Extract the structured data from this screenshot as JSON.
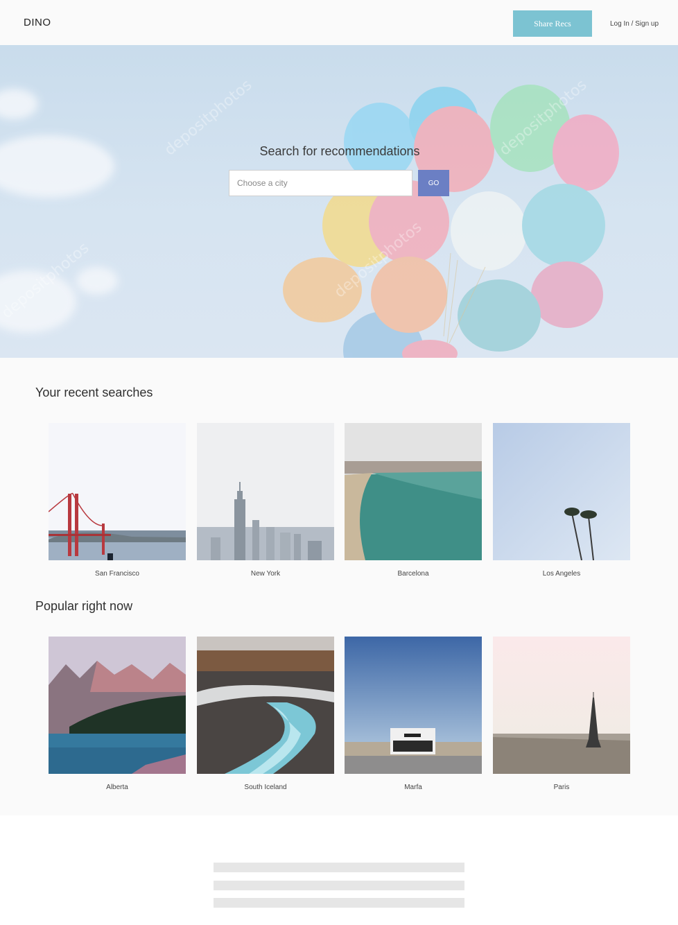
{
  "header": {
    "logo": "DINO",
    "share_button": "Share Recs",
    "login_link": "Log In / Sign up"
  },
  "hero": {
    "title": "Search for recommendations",
    "search_placeholder": "Choose a city",
    "go_button": "GO",
    "watermark": "depositphotos"
  },
  "recent": {
    "title": "Your recent searches",
    "cities": [
      {
        "name": "San Francisco",
        "icon": "golden-gate-photo"
      },
      {
        "name": "New York",
        "icon": "skyline-photo"
      },
      {
        "name": "Barcelona",
        "icon": "beach-photo"
      },
      {
        "name": "Los Angeles",
        "icon": "palm-trees-photo"
      }
    ]
  },
  "popular": {
    "title": "Popular right now",
    "cities": [
      {
        "name": "Alberta",
        "icon": "mountain-lake-photo"
      },
      {
        "name": "South Iceland",
        "icon": "waterfall-photo"
      },
      {
        "name": "Marfa",
        "icon": "desert-store-photo"
      },
      {
        "name": "Paris",
        "icon": "eiffel-tower-photo"
      }
    ]
  },
  "colors": {
    "accent_share": "#7cc3d2",
    "accent_go": "#6b7fc4"
  }
}
